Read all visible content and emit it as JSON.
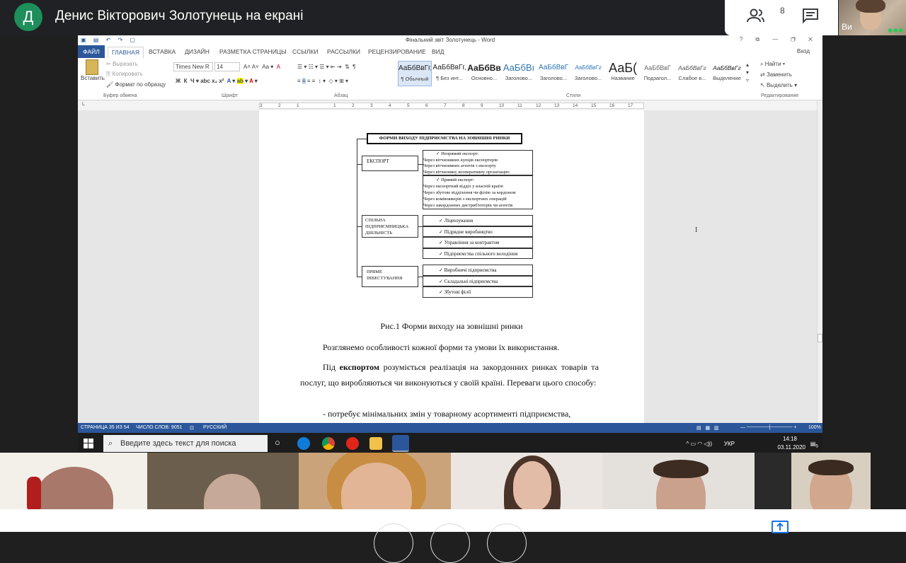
{
  "meet": {
    "avatar_letter": "Д",
    "presenter_title": "Денис Вікторович Золотунець на екрані",
    "people_count": "8",
    "self_label": "Ви"
  },
  "word": {
    "window_title": "Фінальний звіт Золотунець - Word",
    "login": "Вход",
    "tabs": [
      "ФАЙЛ",
      "ГЛАВНАЯ",
      "ВСТАВКА",
      "ДИЗАЙН",
      "РАЗМЕТКА СТРАНИЦЫ",
      "ССЫЛКИ",
      "РАССЫЛКИ",
      "РЕЦЕНЗИРОВАНИЕ",
      "ВИД"
    ],
    "clipboard": {
      "paste": "Вставить",
      "cut": "Вырезать",
      "copy": "Копировать",
      "format_painter": "Формат по образцу",
      "label": "Буфер обмена"
    },
    "font": {
      "name": "Times New R",
      "size": "14",
      "label": "Шрифт"
    },
    "paragraph_label": "Абзац",
    "styles_label": "Стили",
    "styles": [
      {
        "sample": "АаБбВвГг,",
        "name": "¶ Обычный"
      },
      {
        "sample": "АаБбВвГг,",
        "name": "¶ Без инт..."
      },
      {
        "sample": "АаБбВв",
        "name": "Основно..."
      },
      {
        "sample": "АаБбВı",
        "name": "Заголово..."
      },
      {
        "sample": "АаБбВвГ",
        "name": "Заголово..."
      },
      {
        "sample": "АаБбВвГг",
        "name": "Заголово..."
      },
      {
        "sample": "АаБ(",
        "name": "Название"
      },
      {
        "sample": "АаБбВвГ",
        "name": "Подзагол..."
      },
      {
        "sample": "АаБбВвГг",
        "name": "Слабое в..."
      },
      {
        "sample": "АаБбВвГг",
        "name": "Выделение"
      }
    ],
    "editing": {
      "find": "Найти",
      "replace": "Заменить",
      "select": "Выделить",
      "label": "Редактирование"
    },
    "ruler_numbers": [
      "3",
      "2",
      "1",
      "1",
      "2",
      "3",
      "4",
      "5",
      "6",
      "7",
      "8",
      "9",
      "10",
      "11",
      "12",
      "13",
      "14",
      "15",
      "16",
      "17"
    ],
    "diagram": {
      "title": "ФОРМИ ВИХОДУ ПІДПРИЄМСТВА НА ЗОВНІШНІ РИНКИ",
      "export": "ЕКСПОРТ",
      "joint": "СПІЛЬНА ПІДПРИЄМНИЦЬКА ДІЯЛЬНІСТЬ",
      "direct": "ПРЯМЕ ІНВЕСТУВАННЯ",
      "indirect_export": "Непрямий експорт:",
      "indirect_items": [
        "Через вітчизняних купців експортерів",
        "Через вітчизняних агентів з експорту",
        "Через вітчизняну кооперативну організацію"
      ],
      "direct_export": "Прямий експорт:",
      "direct_items": [
        "Через експортний відділ у власній країні",
        "Через збутове відділення чи філію за кордоном",
        "Через комівояжерів з експортних операцій",
        "Через закордонних дистриб'юторів чи агентів"
      ],
      "joint_items": [
        "Ліцензування",
        "Підрядне виробництво",
        "Управління за контрактом",
        "Підприємства спільного володіння"
      ],
      "invest_items": [
        "Виробничі підприємства",
        "Складальні підприємства",
        "Збутові філії"
      ]
    },
    "caption": "Рис.1 Форми виходу на зовнішні ринки",
    "para1": "Розглянемо особливості кожної форми та умови їх використання.",
    "para2_prefix": "Під ",
    "para2_bold": "експортом",
    "para2_rest": " розуміється реалізація на закордонних ринках товарів та послуг, що виробляються чи виконуються у своїй країні. Переваги цього способу:",
    "para3": "- потребує мінімальних змін у товарному асортименті підприємства,",
    "status": {
      "page": "СТРАНИЦА 35 ИЗ 54",
      "words": "ЧИСЛО СЛОВ: 9051",
      "lang": "РУССКИЙ",
      "zoom": "100%"
    }
  },
  "taskbar": {
    "search_placeholder": "Введите здесь текст для поиска",
    "lang": "УКР",
    "time": "14:18",
    "date": "03.11.2020",
    "notif": "5"
  }
}
